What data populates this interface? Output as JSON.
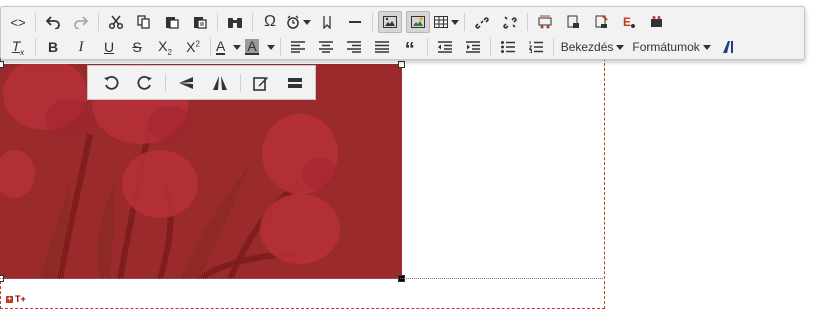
{
  "editor": {
    "toolbar_row1": [
      {
        "name": "source-code-icon",
        "glyph": "<>"
      },
      {
        "name": "undo-icon"
      },
      {
        "name": "redo-icon"
      },
      {
        "name": "cut-icon"
      },
      {
        "name": "copy-icon"
      },
      {
        "name": "paste-icon"
      },
      {
        "name": "paste-text-icon"
      },
      {
        "name": "find-icon"
      },
      {
        "name": "special-char-icon",
        "glyph": "Ω"
      },
      {
        "name": "insert-time-icon"
      },
      {
        "name": "bookmark-icon"
      },
      {
        "name": "horizontal-rule-icon"
      },
      {
        "name": "image-icon"
      },
      {
        "name": "media-icon"
      },
      {
        "name": "table-icon"
      },
      {
        "name": "link-icon"
      },
      {
        "name": "unlink-icon"
      },
      {
        "name": "plugin-icon"
      }
    ],
    "format_paragraph_label": "Bekezdés",
    "format_formats_label": "Formátumok",
    "image_toolbar": [
      {
        "name": "rotate-left-icon"
      },
      {
        "name": "rotate-right-icon"
      },
      {
        "name": "flip-vertical-icon"
      },
      {
        "name": "flip-horizontal-icon"
      },
      {
        "name": "edit-image-icon"
      },
      {
        "name": "image-options-icon"
      }
    ],
    "add_text_label": "T+",
    "colors": {
      "accent_red": "#c0392b",
      "toolbar_bg": "#f2f2f2",
      "image_tint": "#9a2a2c"
    }
  }
}
